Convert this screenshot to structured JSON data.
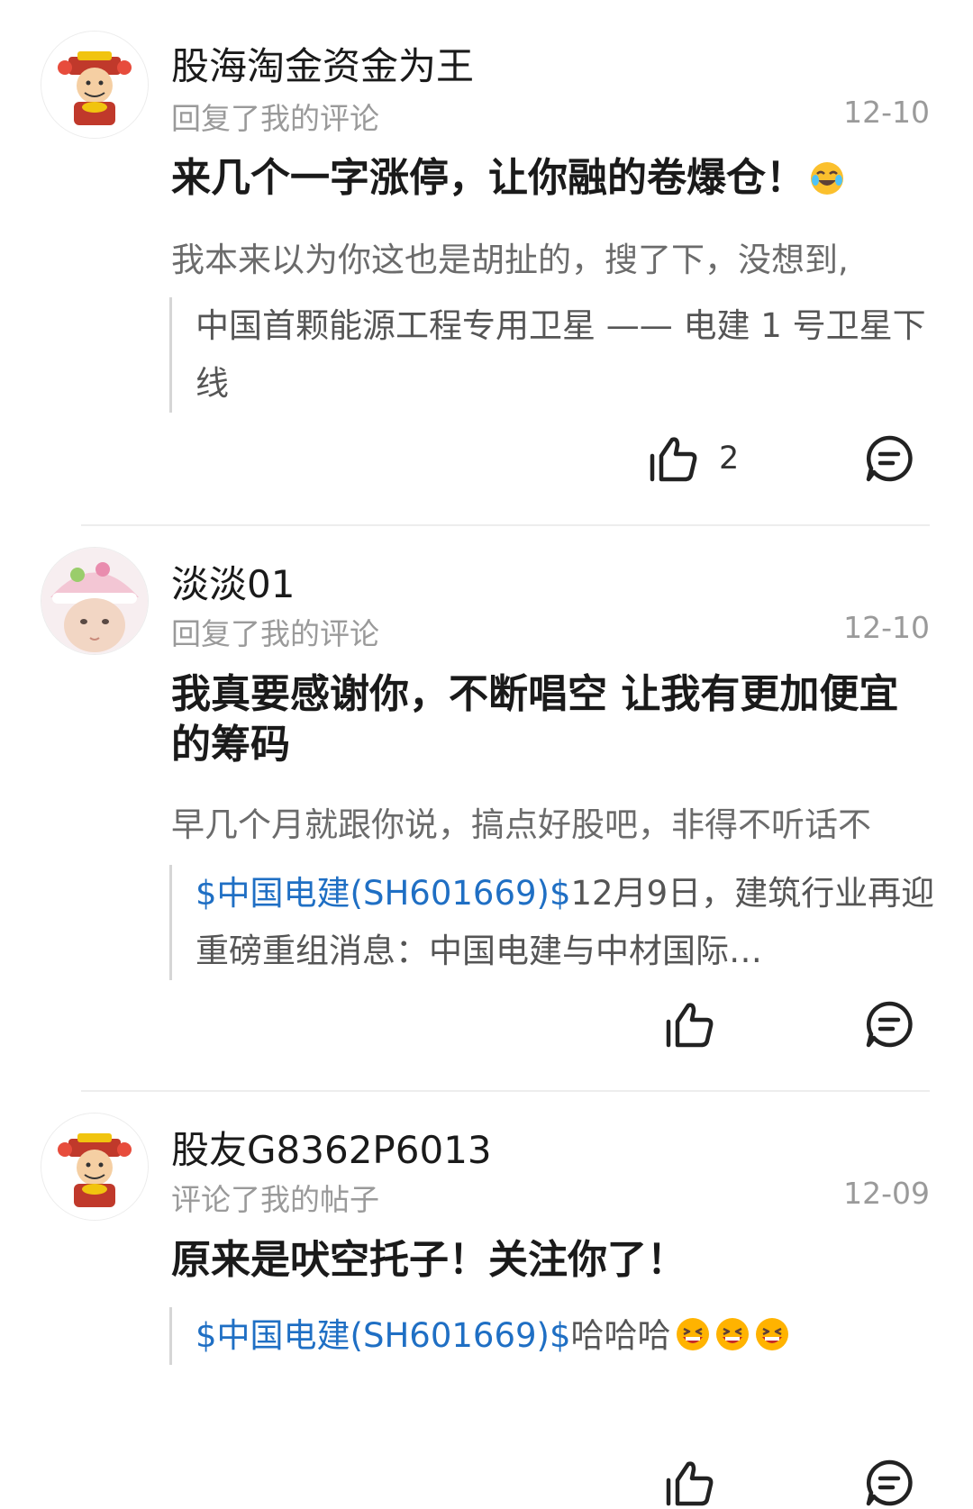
{
  "notifications": [
    {
      "username": "股海淘金资金为王",
      "action": "回复了我的评论",
      "date": "12-10",
      "avatar": "caishen-avatar-icon",
      "comment": "来几个一字涨停，让你融的卷爆仓！",
      "comment_emoji": "crying-laughing-emoji-icon",
      "snippet": "我本来以为你这也是胡扯的，搜了下，没想到,",
      "quote_ticker": "",
      "quote_text": "中国首颗能源工程专用卫星 —— 电建 1 号卫星下线",
      "like_count": "2"
    },
    {
      "username": "淡淡01",
      "action": "回复了我的评论",
      "date": "12-10",
      "avatar": "baby-avatar-icon",
      "comment": "我真要感谢你，不断唱空 让我有更加便宜的筹码",
      "snippet": "早几个月就跟你说，搞点好股吧，非得不听话不",
      "quote_ticker": "$中国电建(SH601669)$",
      "quote_text": "12月9日，建筑行业再迎重磅重组消息：中国电建与中材国际…",
      "like_count": ""
    },
    {
      "username": "股友G8362P6013",
      "action": "评论了我的帖子",
      "date": "12-09",
      "avatar": "caishen-avatar-icon",
      "comment": "原来是吠空托子！关注你了！",
      "snippet": "",
      "quote_ticker": "$中国电建(SH601669)$",
      "quote_text": "哈哈哈",
      "quote_emoji": "grinning-squint-emoji-icon",
      "like_count": ""
    }
  ],
  "colors": {
    "ticker": "#1f6fc4",
    "muted": "#9a9a9a",
    "divider": "#ededed"
  }
}
